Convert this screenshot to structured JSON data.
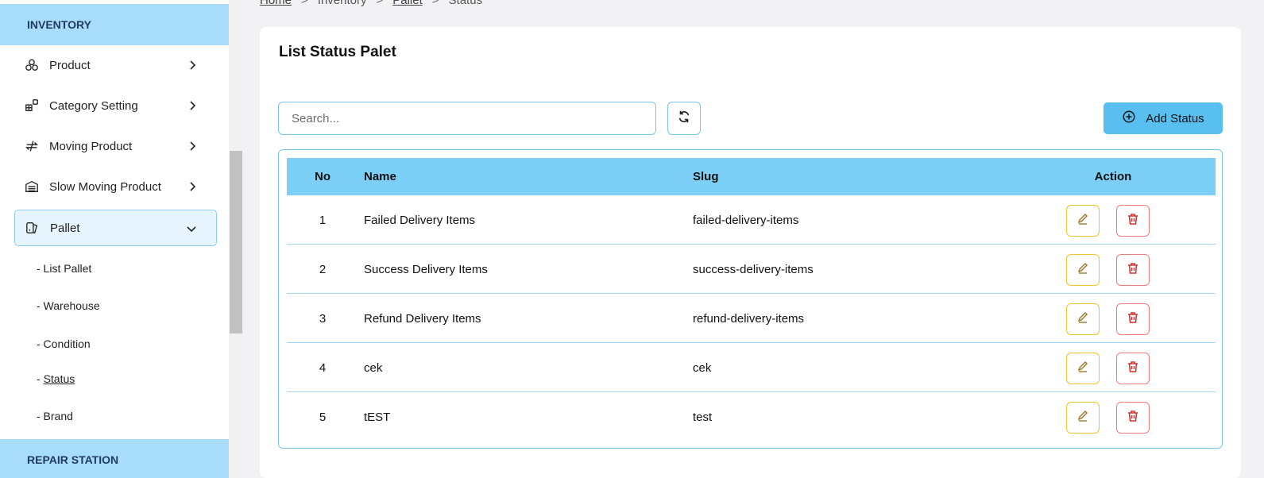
{
  "sidebar": {
    "section_title": "INVENTORY",
    "section_bottom": "REPAIR STATION",
    "items": [
      {
        "label": "Product",
        "icon": "boxes-icon"
      },
      {
        "label": "Category Setting",
        "icon": "category-icon"
      },
      {
        "label": "Moving Product",
        "icon": "moving-arrows-icon"
      },
      {
        "label": "Slow Moving Product",
        "icon": "warehouse-icon"
      },
      {
        "label": "Pallet",
        "icon": "pallet-icon"
      }
    ],
    "subitems": [
      "- List Pallet",
      "- Warehouse",
      "- Condition",
      "- ",
      "Status",
      "- Brand"
    ]
  },
  "breadcrumb": {
    "home": "Home",
    "inventory": "Inventory",
    "pallet": "Pallet",
    "status": "Status",
    "sep": ">"
  },
  "main": {
    "title": "List Status Palet",
    "search_placeholder": "Search...",
    "add_label": "Add Status",
    "table": {
      "headers": {
        "no": "No",
        "name": "Name",
        "slug": "Slug",
        "action": "Action"
      },
      "rows": [
        {
          "no": "1",
          "name": "Failed Delivery Items",
          "slug": "failed-delivery-items"
        },
        {
          "no": "2",
          "name": "Success Delivery Items",
          "slug": "success-delivery-items"
        },
        {
          "no": "3",
          "name": "Refund Delivery Items",
          "slug": "refund-delivery-items"
        },
        {
          "no": "4",
          "name": "cek",
          "slug": "cek"
        },
        {
          "no": "5",
          "name": "tEST",
          "slug": "test"
        }
      ]
    }
  },
  "colors": {
    "accent": "#58bff0",
    "header_bg": "#7cd0f8",
    "sidebar_section": "#a8dcfb",
    "edit_border": "#f4c430",
    "delete_border": "#ee7d7d"
  }
}
